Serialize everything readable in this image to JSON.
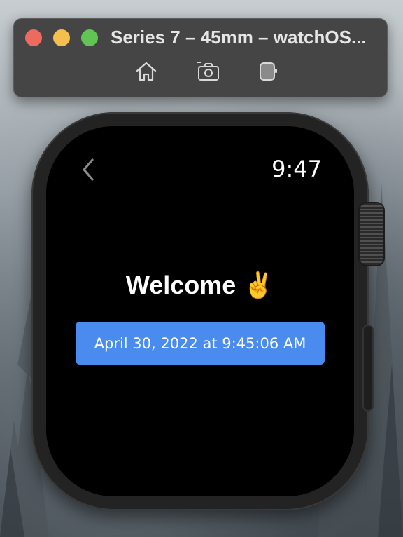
{
  "window": {
    "title": "Series 7 – 45mm – watchOS...",
    "toolbar_icons": [
      "home-icon",
      "screenshot-icon",
      "rotate-device-icon"
    ]
  },
  "watch_app": {
    "back_icon": "chevron-left-icon",
    "time": "9:47",
    "welcome_text": "Welcome",
    "welcome_emoji": "✌️",
    "date_button_label": "April 30, 2022 at 9:45:06 AM"
  },
  "colors": {
    "accent_button": "#4a8bf0",
    "close": "#ed6a5e",
    "minimize": "#f4bf4f",
    "zoom": "#61c554"
  }
}
